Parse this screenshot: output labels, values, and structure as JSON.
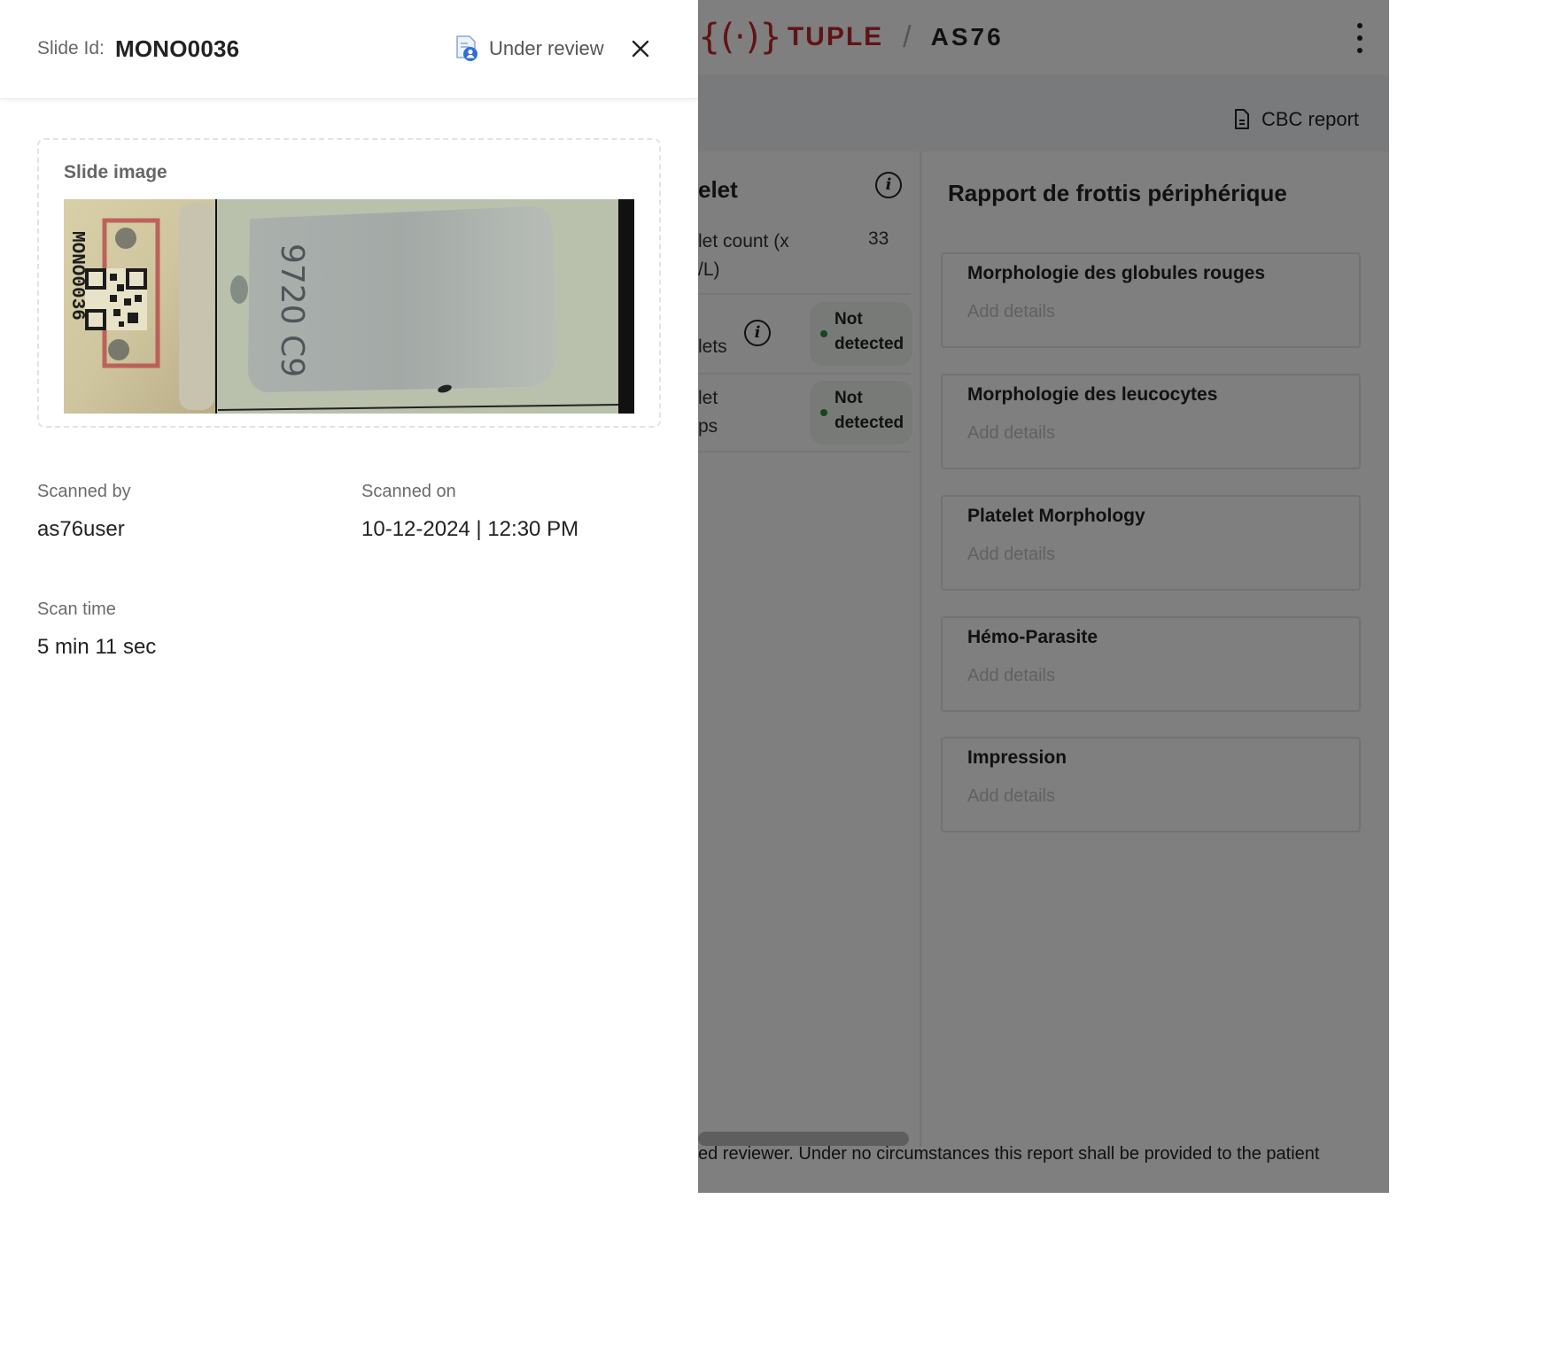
{
  "app": {
    "logo_brand": "TUPLE",
    "logo_separator": "/",
    "logo_product": "AS76",
    "cbc_report_label": "CBC report"
  },
  "platelet_panel": {
    "title": "elet",
    "rows": [
      {
        "label": "let count (x /L)",
        "value": "33"
      },
      {
        "label": "lets",
        "status": "Not detected"
      },
      {
        "label": "let ps",
        "status": "Not detected"
      }
    ]
  },
  "report_panel": {
    "title": "Rapport de frottis périphérique",
    "cards": [
      {
        "title": "Morphologie des globules rouges",
        "placeholder": "Add details"
      },
      {
        "title": "Morphologie des leucocytes",
        "placeholder": "Add details"
      },
      {
        "title": "Platelet Morphology",
        "placeholder": "Add details"
      },
      {
        "title": "Hémo-Parasite",
        "placeholder": "Add details"
      },
      {
        "title": "Impression",
        "placeholder": "Add details"
      }
    ]
  },
  "footer": {
    "disclaimer": "ed reviewer. Under no circumstances this report shall be provided to the patient"
  },
  "drawer": {
    "slide_id_label": "Slide Id:",
    "slide_id": "MONO0036",
    "review_status": "Under review",
    "slide_image_label": "Slide image",
    "slide_label_text": "MONO0036",
    "slide_handwriting": "9720 C9",
    "scanned_by_label": "Scanned by",
    "scanned_by": "as76user",
    "scanned_on_label": "Scanned on",
    "scanned_on": "10-12-2024 | 12:30 PM",
    "scan_time_label": "Scan time",
    "scan_time": "5 min 11 sec"
  },
  "colors": {
    "brand_red": "#c0262d",
    "status_green": "#2e8b3a",
    "review_icon_blue": "#2f6fd6",
    "overlay": "rgba(0,0,0,0.5)"
  },
  "icons": {
    "review": "document-user-icon",
    "close": "close-icon",
    "report": "document-icon",
    "menu": "kebab-menu-icon",
    "info": "info-icon"
  }
}
